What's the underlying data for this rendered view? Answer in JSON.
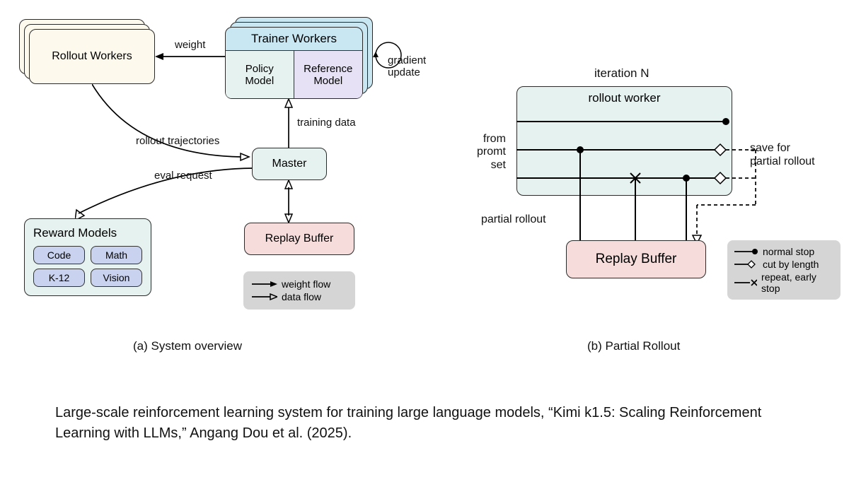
{
  "diagram_a": {
    "rollout_workers": "Rollout Workers",
    "trainer_workers": {
      "title": "Trainer Workers",
      "policy": "Policy\nModel",
      "reference": "Reference\nModel"
    },
    "gradient_update": "gradient\nupdate",
    "weight_label": "weight",
    "rollout_traj_label": "rollout trajectories",
    "eval_request_label": "eval request",
    "training_data_label": "training data",
    "master": "Master",
    "reward_models": {
      "title": "Reward Models",
      "items": [
        "Code",
        "Math",
        "K-12",
        "Vision"
      ]
    },
    "replay_buffer": "Replay Buffer",
    "legend": {
      "weight_flow": "weight flow",
      "data_flow": "data flow"
    },
    "caption": "(a) System overview"
  },
  "diagram_b": {
    "iteration": "iteration N",
    "rollout_worker": "rollout worker",
    "from_prompt_set": "from\npromt\nset",
    "save_partial": "save for\npartial rollout",
    "partial_rollout_label": "partial rollout",
    "replay_buffer": "Replay Buffer",
    "legend": {
      "normal_stop": "normal stop",
      "cut_by_length": "cut by length",
      "repeat_early_stop": "repeat, early stop"
    },
    "caption": "(b) Partial Rollout"
  },
  "citation": "Large-scale reinforcement learning system for training large language models, “Kimi k1.5: Scaling Reinforcement Learning with LLMs,” Angang Dou et al. (2025).",
  "colors": {
    "cream": "#fdf9ec",
    "mint": "#e6f2f0",
    "lavender": "#e7e1f5",
    "pink": "#f6dddb",
    "bluefill": "#c9d3ef",
    "gray": "#d5d5d5"
  }
}
